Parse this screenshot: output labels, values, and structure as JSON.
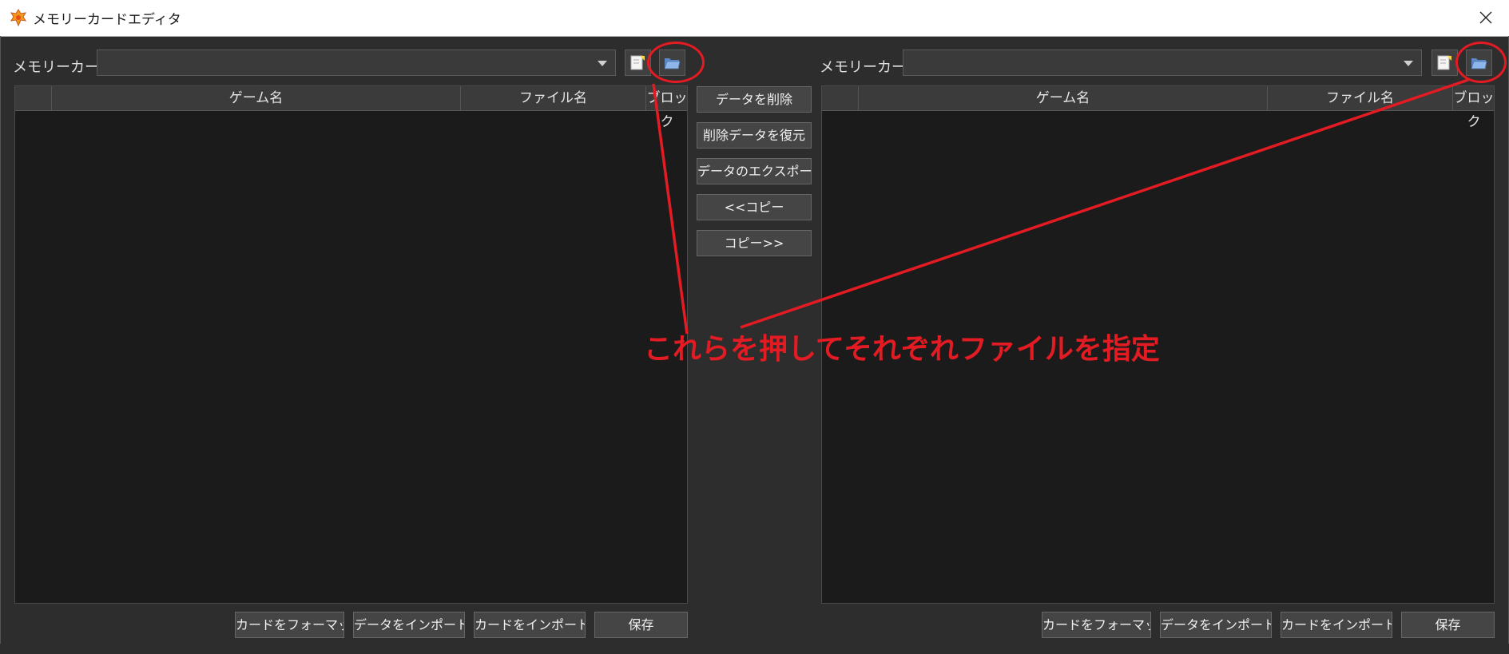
{
  "window": {
    "title": "メモリーカードエディタ"
  },
  "left": {
    "card_label": "メモリーカード:",
    "card_value": "",
    "columns": [
      "",
      "ゲーム名",
      "ファイル名",
      "ブロック"
    ],
    "buttons": {
      "format": "カードをフォーマット",
      "import_data": "データをインポート...",
      "import_card": "カードをインポート...",
      "save": "保存"
    }
  },
  "right": {
    "card_label": "メモリーカード:",
    "card_value": "",
    "columns": [
      "",
      "ゲーム名",
      "ファイル名",
      "ブロック"
    ],
    "buttons": {
      "format": "カードをフォーマット",
      "import_data": "データをインポート...",
      "import_card": "カードをインポート...",
      "save": "保存"
    }
  },
  "middle": {
    "delete": "データを削除",
    "restore": "削除データを復元",
    "export": "データのエクスポート",
    "copy_left": "<<コピー",
    "copy_right": "コピー>>"
  },
  "annotation": {
    "text": "これらを押してそれぞれファイルを指定",
    "color": "#e31b23"
  },
  "icons": [
    "app-icon",
    "new-card-icon",
    "open-folder-icon",
    "close-icon",
    "dropdown-arrow-icon"
  ]
}
